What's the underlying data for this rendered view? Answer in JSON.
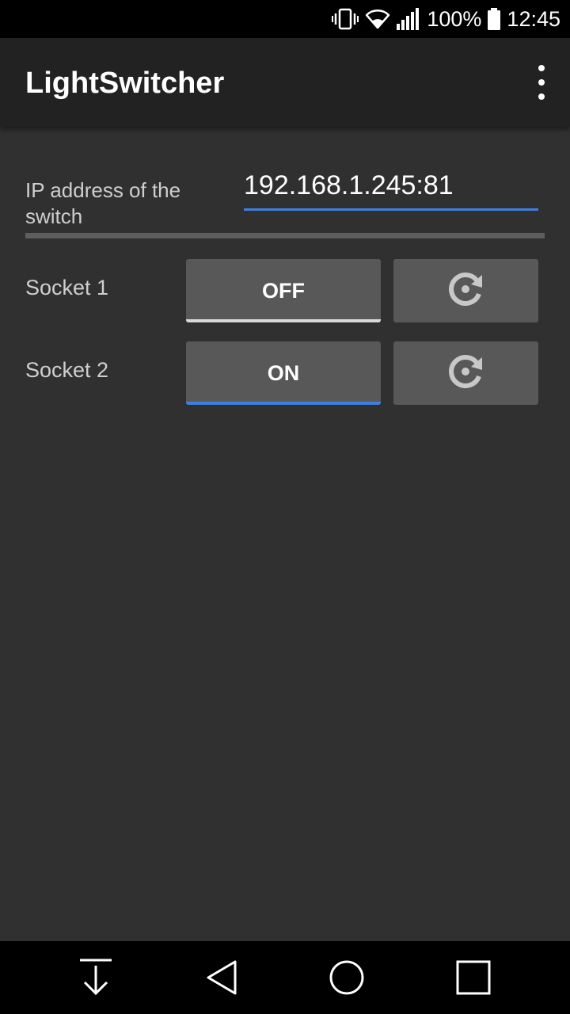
{
  "status_bar": {
    "battery": "100%",
    "time": "12:45",
    "icons": [
      "vibrate-icon",
      "wifi-icon",
      "signal-icon",
      "battery-icon"
    ]
  },
  "app_bar": {
    "title": "LightSwitcher",
    "menu_icon": "overflow-menu-icon"
  },
  "ip_field": {
    "label": "IP address of the switch",
    "value": "192.168.1.245:81"
  },
  "sockets": [
    {
      "label": "Socket 1",
      "state_label": "OFF",
      "indicator_color": "#d8d8d8",
      "refresh_icon": "refresh-icon"
    },
    {
      "label": "Socket 2",
      "state_label": "ON",
      "indicator_color": "#3f7fe0",
      "refresh_icon": "refresh-icon"
    }
  ],
  "nav_bar": {
    "icons": [
      "download-icon",
      "back-icon",
      "home-icon",
      "recents-icon"
    ]
  },
  "colors": {
    "accent": "#3f7fe0",
    "background": "#303030",
    "app_bar": "#222222",
    "button": "#585858"
  }
}
